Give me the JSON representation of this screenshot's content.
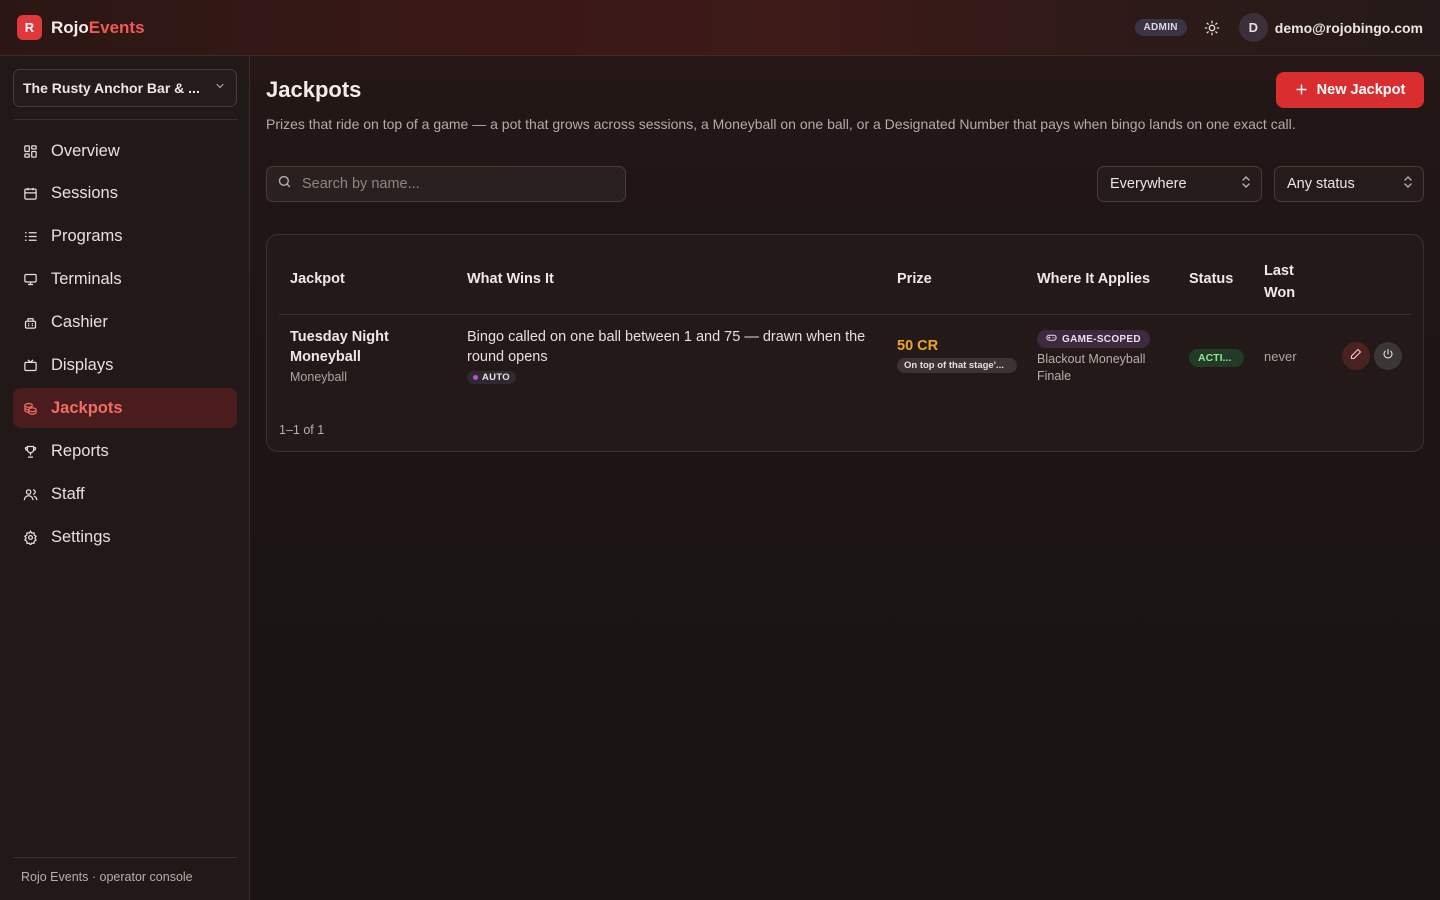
{
  "brand": {
    "logo_letter": "R",
    "name_part1": "Rojo",
    "name_part2": "Events"
  },
  "header": {
    "role_badge": "ADMIN",
    "avatar_initial": "D",
    "user_email": "demo@rojobingo.com"
  },
  "sidebar": {
    "venue": "The Rusty Anchor Bar & ...",
    "items": [
      {
        "label": "Overview",
        "icon": "grid-icon"
      },
      {
        "label": "Sessions",
        "icon": "calendar-icon"
      },
      {
        "label": "Programs",
        "icon": "list-icon"
      },
      {
        "label": "Terminals",
        "icon": "monitor-icon"
      },
      {
        "label": "Cashier",
        "icon": "cashier-icon"
      },
      {
        "label": "Displays",
        "icon": "tv-icon"
      },
      {
        "label": "Jackpots",
        "icon": "coins-icon",
        "active": true
      },
      {
        "label": "Reports",
        "icon": "trophy-icon"
      },
      {
        "label": "Staff",
        "icon": "users-icon"
      },
      {
        "label": "Settings",
        "icon": "gear-icon"
      }
    ],
    "footer": "Rojo Events · operator console"
  },
  "page": {
    "title": "Jackpots",
    "subtitle": "Prizes that ride on top of a game — a pot that grows across sessions, a Moneyball on one ball, or a Designated Number that pays when bingo lands on one exact call.",
    "new_button": "New Jackpot"
  },
  "filters": {
    "search_placeholder": "Search by name...",
    "scope_value": "Everywhere",
    "status_value": "Any status"
  },
  "table": {
    "columns": {
      "jackpot": "Jackpot",
      "wins": "What Wins It",
      "prize": "Prize",
      "applies": "Where It Applies",
      "status": "Status",
      "last_won_1": "Last",
      "last_won_2": "Won"
    },
    "rows": [
      {
        "name_line1": "Tuesday Night",
        "name_line2": "Moneyball",
        "type": "Moneyball",
        "wins_line1": "Bingo called on one ball between 1 and 75 — drawn when the",
        "wins_line2": "round opens",
        "wins_badge": "AUTO",
        "prize": "50 CR",
        "prize_note": "On top of that stage'...",
        "scope_badge": "GAME-SCOPED",
        "scope_line1": "Blackout Moneyball",
        "scope_line2": "Finale",
        "status": "ACTI...",
        "last_won": "never"
      }
    ],
    "pagination": "1–1 of 1"
  },
  "colors": {
    "accent": "#d92e2f",
    "active_nav_bg": "#4a1c1e",
    "prize": "#f0a623",
    "status_active": "#8fe39a"
  }
}
